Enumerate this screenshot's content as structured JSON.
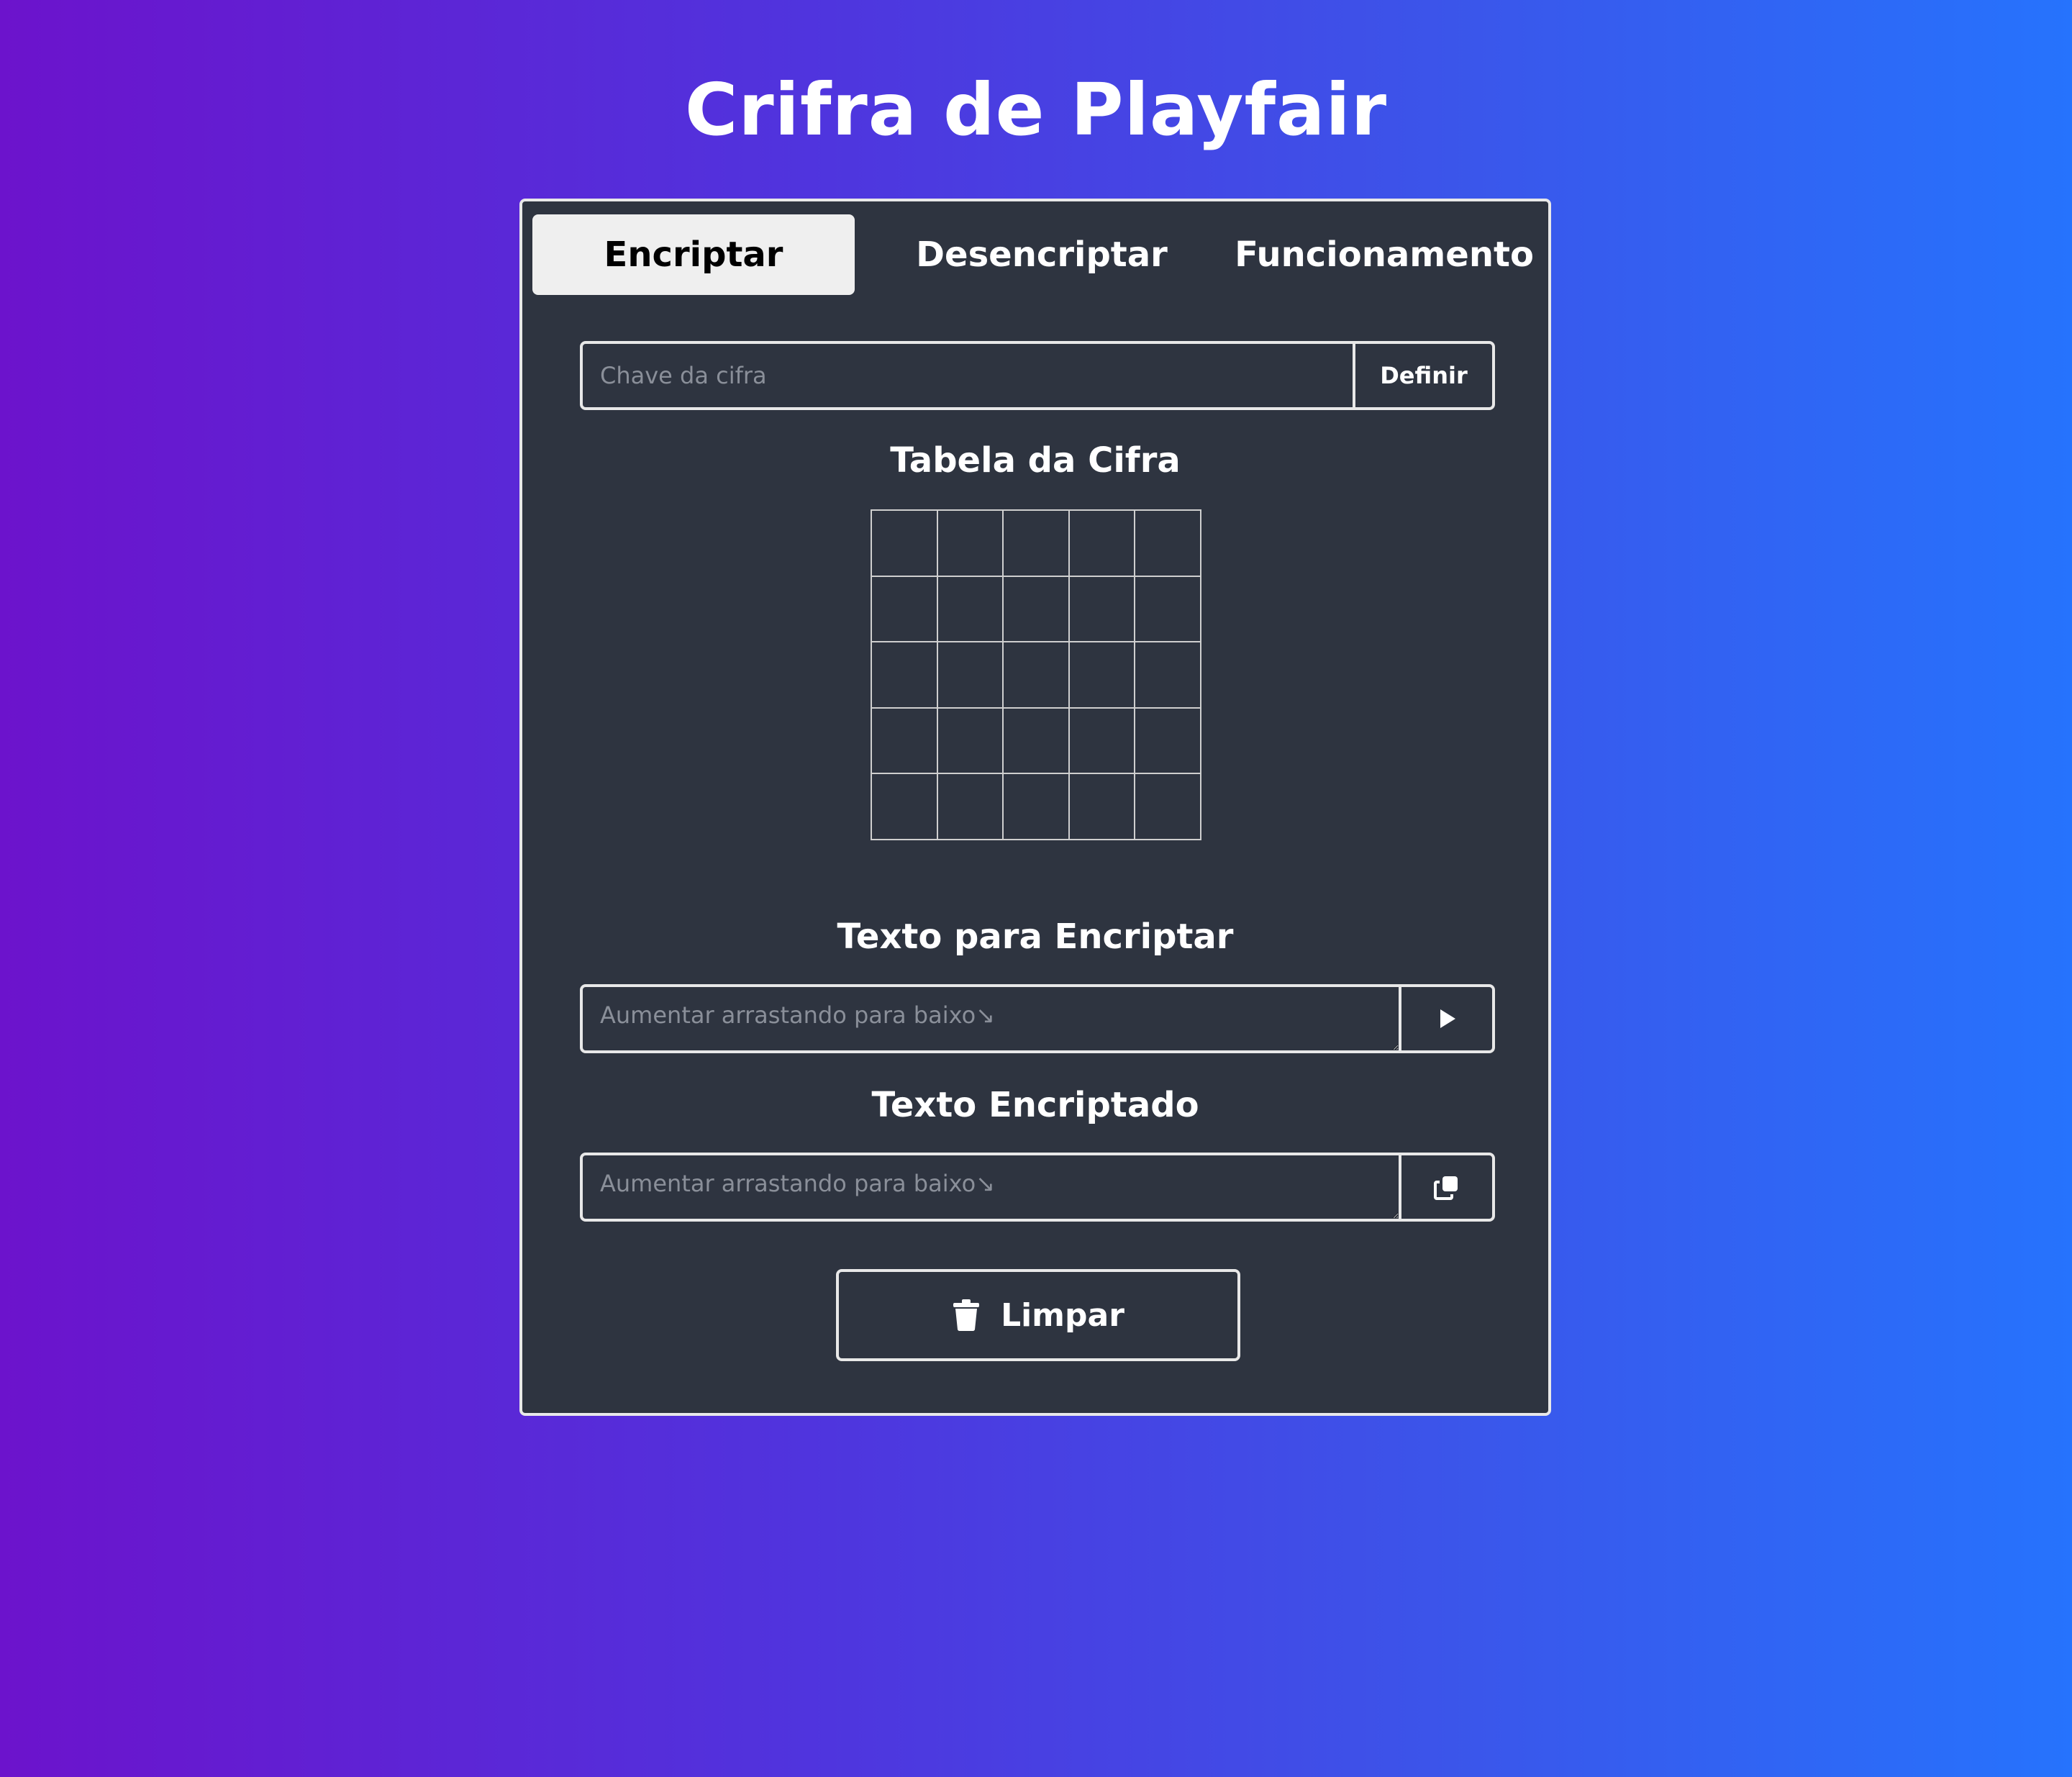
{
  "page": {
    "title": "Crifra de Playfair"
  },
  "tabs": [
    {
      "label": "Encriptar",
      "active": true
    },
    {
      "label": "Desencriptar",
      "active": false
    },
    {
      "label": "Funcionamento",
      "active": false
    }
  ],
  "key": {
    "value": "",
    "placeholder": "Chave da cifra",
    "button_label": "Definir"
  },
  "table": {
    "title": "Tabela da Cifra",
    "rows": [
      [
        "",
        "",
        "",
        "",
        ""
      ],
      [
        "",
        "",
        "",
        "",
        ""
      ],
      [
        "",
        "",
        "",
        "",
        ""
      ],
      [
        "",
        "",
        "",
        "",
        ""
      ],
      [
        "",
        "",
        "",
        "",
        ""
      ]
    ]
  },
  "plaintext": {
    "title": "Texto para Encriptar",
    "value": "",
    "placeholder": "Aumentar arrastando para baixo↘",
    "button_icon": "play-icon"
  },
  "ciphertext": {
    "title": "Texto Encriptado",
    "value": "",
    "placeholder": "Aumentar arrastando para baixo↘",
    "button_icon": "copy-icon"
  },
  "clear": {
    "label": "Limpar",
    "icon": "trash-icon"
  },
  "colors": {
    "card_background": "#2e3440",
    "gradient_start": "#6c13cc",
    "gradient_end": "#2673fd",
    "active_tab_background": "#efefef"
  }
}
